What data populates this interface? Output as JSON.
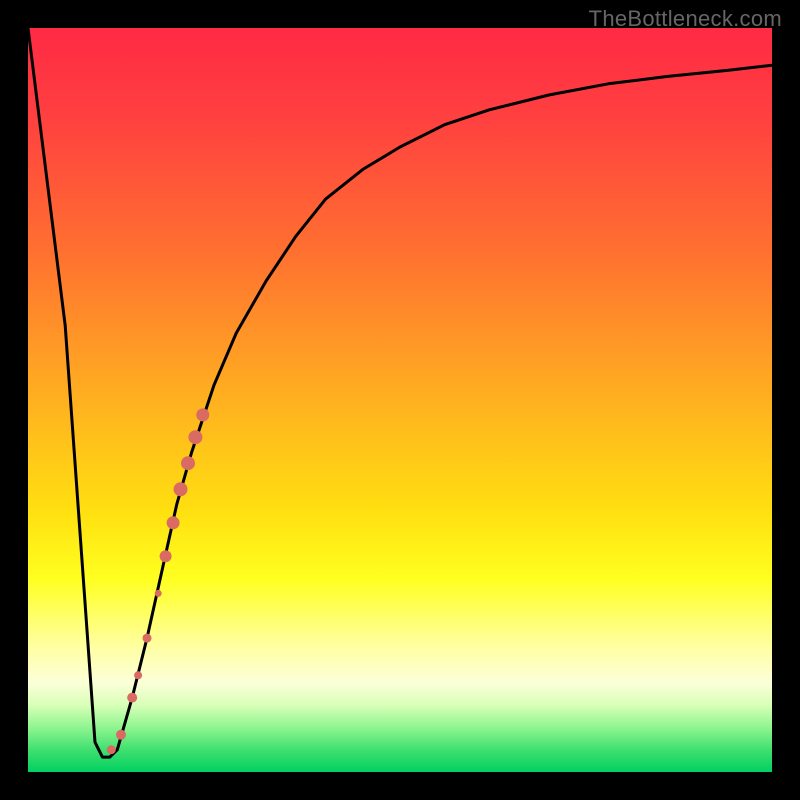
{
  "watermark": "TheBottleneck.com",
  "colors": {
    "curve_stroke": "#000000",
    "dot_fill": "#d96b63",
    "gradient_top": "#ff2a44",
    "gradient_bottom": "#00d060"
  },
  "chart_data": {
    "type": "line",
    "title": "",
    "xlabel": "",
    "ylabel": "",
    "xlim": [
      0,
      100
    ],
    "ylim": [
      0,
      100
    ],
    "annotations": [
      "TheBottleneck.com"
    ],
    "series": [
      {
        "name": "bottleneck-curve",
        "x": [
          0,
          5,
          9,
          10,
          11,
          12,
          14,
          16,
          18,
          20,
          22,
          25,
          28,
          32,
          36,
          40,
          45,
          50,
          56,
          62,
          70,
          78,
          86,
          94,
          100
        ],
        "values": [
          100,
          60,
          4,
          2,
          2,
          3,
          10,
          18,
          27,
          36,
          43,
          52,
          59,
          66,
          72,
          77,
          81,
          84,
          87,
          89,
          91,
          92.5,
          93.5,
          94.3,
          95
        ]
      }
    ],
    "highlight_dots": {
      "name": "dots",
      "color": "#d96b63",
      "points": [
        {
          "x": 11.2,
          "y": 3.0,
          "r": 4.5
        },
        {
          "x": 12.5,
          "y": 5.0,
          "r": 5.0
        },
        {
          "x": 14.0,
          "y": 10.0,
          "r": 5.0
        },
        {
          "x": 14.8,
          "y": 13.0,
          "r": 4.0
        },
        {
          "x": 16.0,
          "y": 18.0,
          "r": 4.5
        },
        {
          "x": 17.5,
          "y": 24.0,
          "r": 3.5
        },
        {
          "x": 18.5,
          "y": 29.0,
          "r": 6.0
        },
        {
          "x": 19.5,
          "y": 33.5,
          "r": 6.5
        },
        {
          "x": 20.5,
          "y": 38.0,
          "r": 7.0
        },
        {
          "x": 21.5,
          "y": 41.5,
          "r": 7.0
        },
        {
          "x": 22.5,
          "y": 45.0,
          "r": 7.0
        },
        {
          "x": 23.5,
          "y": 48.0,
          "r": 6.5
        }
      ]
    }
  }
}
